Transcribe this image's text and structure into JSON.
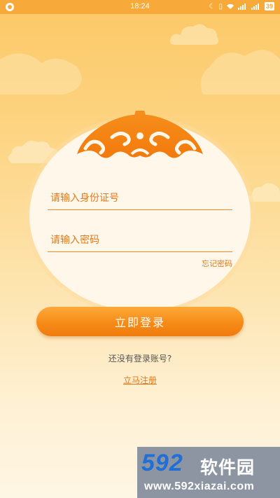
{
  "status_bar": {
    "time": "18:24",
    "battery": "39",
    "icons": [
      "notification-icon",
      "moon-icon",
      "vibrate-icon",
      "wifi-icon",
      "signal-icon",
      "signal-icon",
      "battery-icon"
    ]
  },
  "login": {
    "id_placeholder": "请输入身份证号",
    "password_placeholder": "请输入密码",
    "forgot_password": "忘记密码",
    "login_button": "立即登录",
    "no_account": "还没有登录账号?",
    "register_link": "立马注册"
  },
  "watermark": {
    "brand_number": "592",
    "brand_name": "软件园",
    "url": "www.592xiazai.com"
  },
  "colors": {
    "accent": "#f68b17",
    "status_bar": "#f7a93a",
    "placeholder": "#e07a1c"
  }
}
